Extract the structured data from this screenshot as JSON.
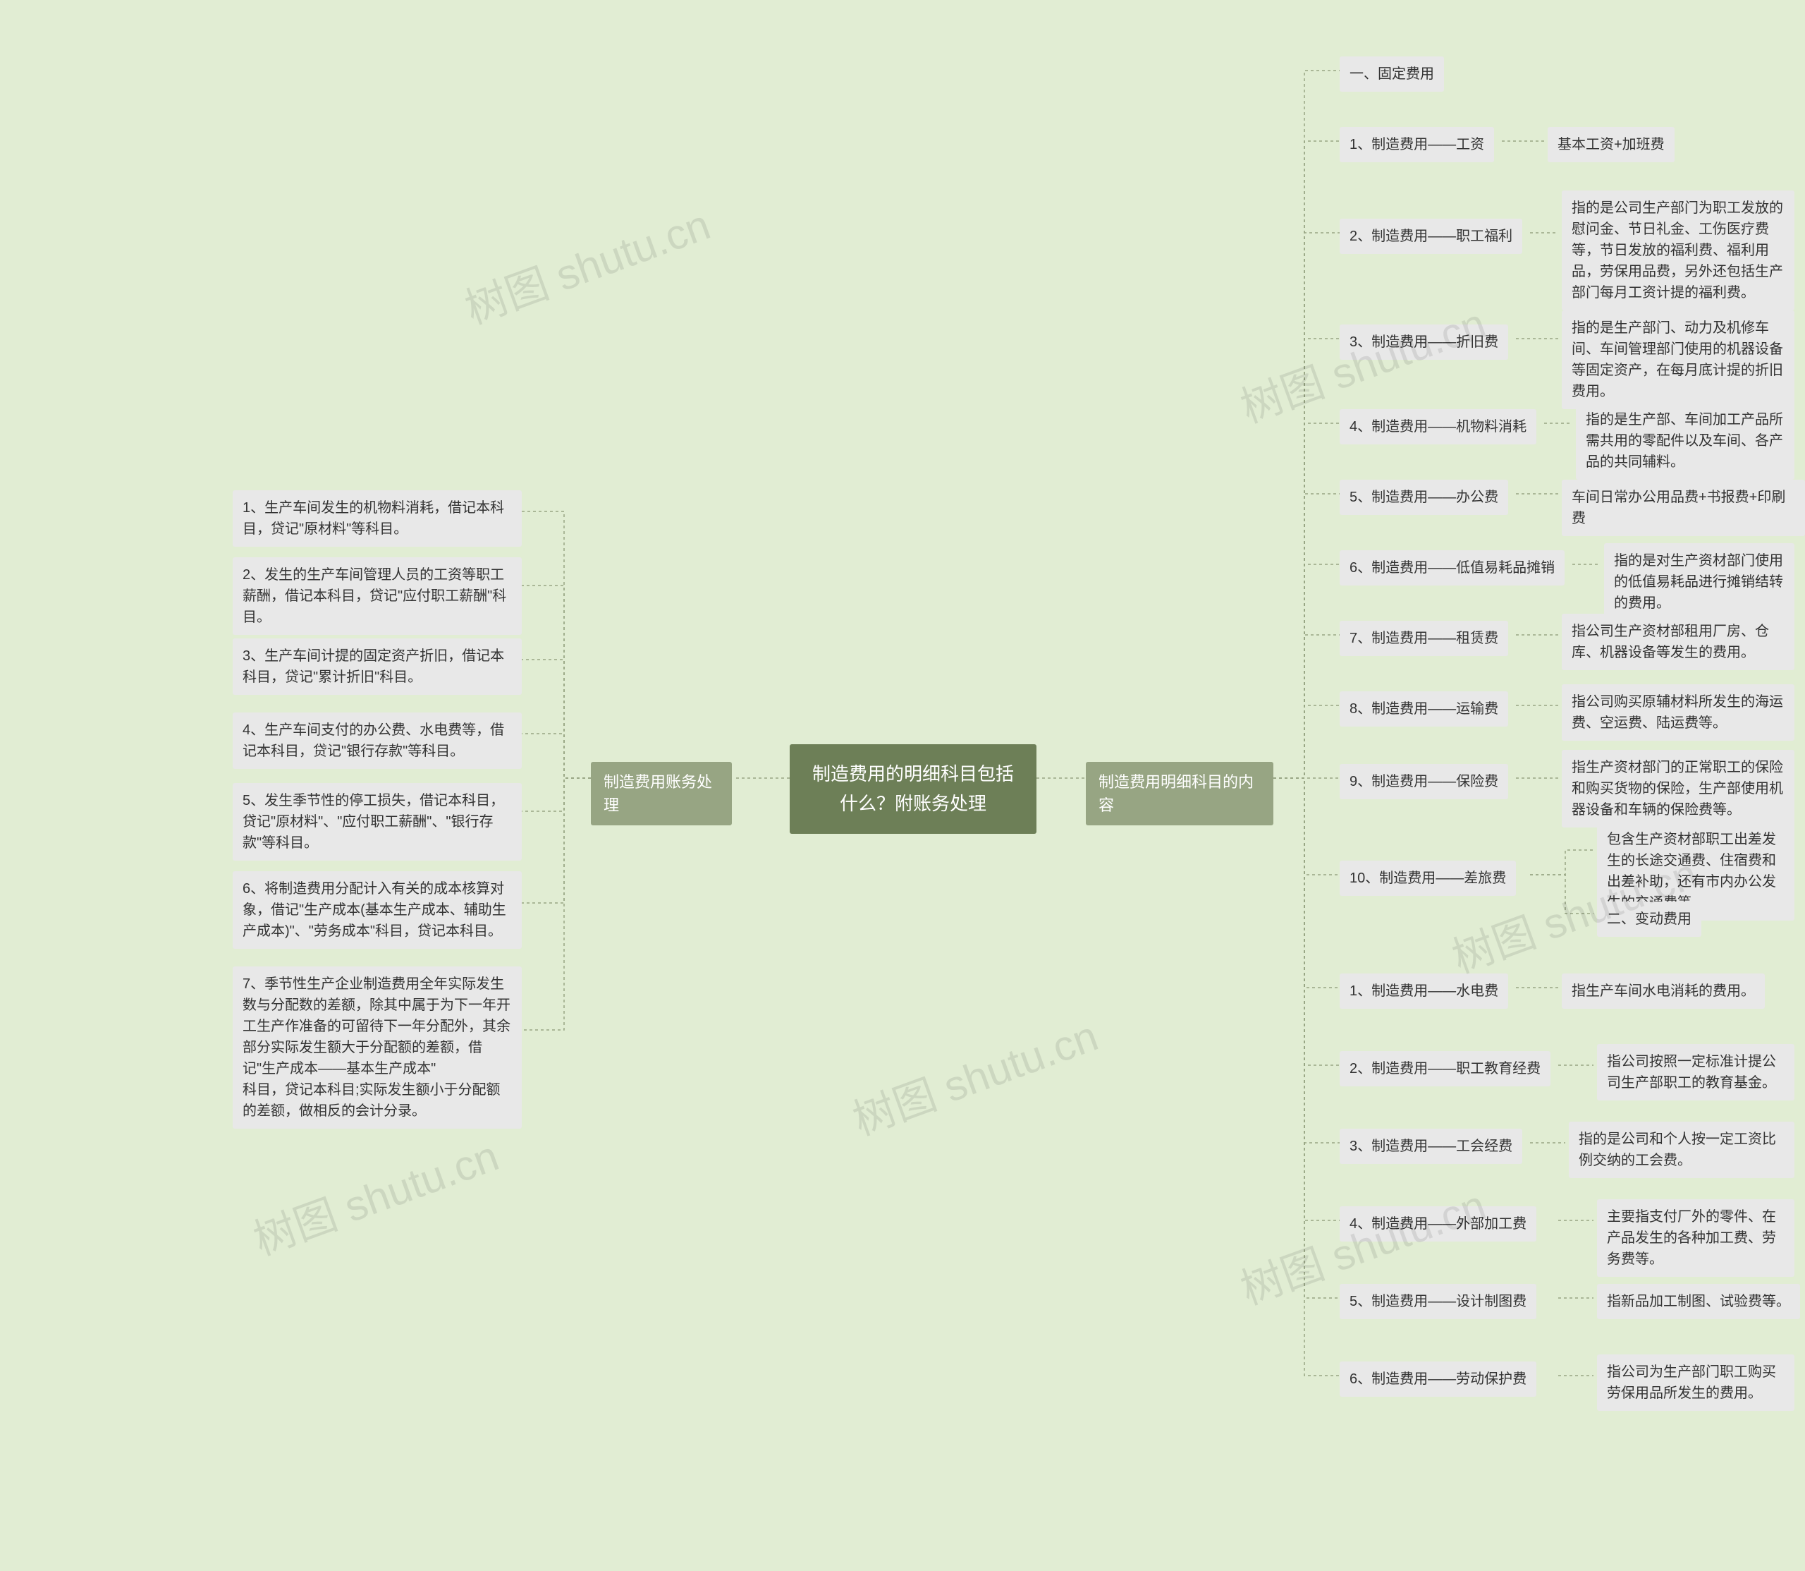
{
  "root": {
    "title": "制造费用的明细科目包括什么？附账务处理"
  },
  "branches": {
    "left": {
      "label": "制造费用账务处理"
    },
    "right": {
      "label": "制造费用明细科目的内容"
    }
  },
  "left_items": [
    {
      "text": "1、生产车间发生的机物料消耗，借记本科目，贷记\"原材料\"等科目。"
    },
    {
      "text": "2、发生的生产车间管理人员的工资等职工薪酬，借记本科目，贷记\"应付职工薪酬\"科目。"
    },
    {
      "text": "3、生产车间计提的固定资产折旧，借记本科目，贷记\"累计折旧\"科目。"
    },
    {
      "text": "4、生产车间支付的办公费、水电费等，借记本科目，贷记\"银行存款\"等科目。"
    },
    {
      "text": "5、发生季节性的停工损失，借记本科目，贷记\"原材料\"、\"应付职工薪酬\"、\"银行存款\"等科目。"
    },
    {
      "text": "6、将制造费用分配计入有关的成本核算对象，借记\"生产成本(基本生产成本、辅助生产成本)\"、\"劳务成本\"科目，贷记本科目。"
    },
    {
      "text": "7、季节性生产企业制造费用全年实际发生数与分配数的差额，除其中属于为下一年开工生产作准备的可留待下一年分配外，其余部分实际发生额大于分配额的差额，借记\"生产成本——基本生产成本\"\n科目，贷记本科目;实际发生额小于分配额的差额，做相反的会计分录。"
    }
  ],
  "right_items": [
    {
      "label": "一、固定费用",
      "desc": ""
    },
    {
      "label": "1、制造费用——工资",
      "desc": "基本工资+加班费"
    },
    {
      "label": "2、制造费用——职工福利",
      "desc": "指的是公司生产部门为职工发放的慰问金、节日礼金、工伤医疗费等，节日发放的福利费、福利用品，劳保用品费，另外还包括生产部门每月工资计提的福利费。"
    },
    {
      "label": "3、制造费用——折旧费",
      "desc": "指的是生产部门、动力及机修车间、车间管理部门使用的机器设备等固定资产，在每月底计提的折旧费用。"
    },
    {
      "label": "4、制造费用——机物料消耗",
      "desc": "指的是生产部、车间加工产品所需共用的零配件以及车间、各产品的共同辅料。"
    },
    {
      "label": "5、制造费用——办公费",
      "desc": "车间日常办公用品费+书报费+印刷费"
    },
    {
      "label": "6、制造费用——低值易耗品摊销",
      "desc": "指的是对生产资材部门使用的低值易耗品进行摊销结转的费用。"
    },
    {
      "label": "7、制造费用——租赁费",
      "desc": "指公司生产资材部租用厂房、仓库、机器设备等发生的费用。"
    },
    {
      "label": "8、制造费用——运输费",
      "desc": "指公司购买原辅材料所发生的海运费、空运费、陆运费等。"
    },
    {
      "label": "9、制造费用——保险费",
      "desc": "指生产资材部门的正常职工的保险和购买货物的保险，生产部使用机器设备和车辆的保险费等。"
    },
    {
      "label": "10、制造费用——差旅费",
      "desc": "包含生产资材部职工出差发生的长途交通费、住宿费和出差补助，还有市内办公发生的交通费等。",
      "subnote": "二、变动费用"
    },
    {
      "label": "1、制造费用——水电费",
      "desc": "指生产车间水电消耗的费用。"
    },
    {
      "label": "2、制造费用——职工教育经费",
      "desc": "指公司按照一定标准计提公司生产部职工的教育基金。"
    },
    {
      "label": "3、制造费用——工会经费",
      "desc": "指的是公司和个人按一定工资比例交纳的工会费。"
    },
    {
      "label": "4、制造费用——外部加工费",
      "desc": "主要指支付厂外的零件、在产品发生的各种加工费、劳务费等。"
    },
    {
      "label": "5、制造费用——设计制图费",
      "desc": "指新品加工制图、试验费等。"
    },
    {
      "label": "6、制造费用——劳动保护费",
      "desc": "指公司为生产部门职工购买劳保用品所发生的费用。"
    }
  ],
  "watermark": "树图 shutu.cn"
}
